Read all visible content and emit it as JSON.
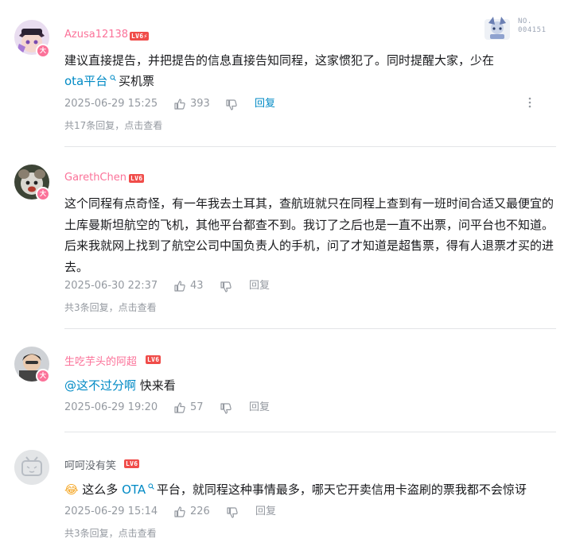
{
  "comments": [
    {
      "username": "Azusa12138",
      "level": "LV6",
      "badge_glyph": "⚡",
      "vip": "大",
      "content_parts": [
        "建议直接提告，并把提告的信息直接告知同程，这家惯犯了。同时提醒大家，少在",
        "ota平台",
        "买机票"
      ],
      "date": "2025-06-29 15:25",
      "likes": "393",
      "reply_label": "回复",
      "reply_summary": "共17条回复，点击查看",
      "nft_label": "NO.",
      "nft_number": "004151"
    },
    {
      "username": "GarethChen",
      "level": "LV6",
      "vip": "大",
      "content": "这个同程有点奇怪，有一年我去土耳其，查航班就只在同程上查到有一班时间合适又最便宜的土库曼斯坦航空的飞机，其他平台都查不到。我订了之后也是一直不出票，问平台也不知道。后来我就网上找到了航空公司中国负责人的手机，问了才知道是超售票，得有人退票才买的进去。",
      "date": "2025-06-30 22:37",
      "likes": "43",
      "reply_label": "回复",
      "reply_summary": "共3条回复，点击查看"
    },
    {
      "username": "生吃芋头的阿超",
      "level": "LV6",
      "vip": "大",
      "mention": "@这不过分啊",
      "content": " 快来看",
      "date": "2025-06-29 19:20",
      "likes": "57",
      "reply_label": "回复"
    },
    {
      "username": "呵呵没有笑",
      "level": "LV6",
      "emoji": "😂",
      "content_parts": [
        " 这么多 ",
        "OTA",
        " 平台，就同程这种事情最多，哪天它开卖信用卡盗刷的票我都不会惊讶"
      ],
      "date": "2025-06-29 15:14",
      "likes": "226",
      "reply_label": "回复",
      "reply_summary": "共3条回复，点击查看"
    }
  ],
  "icons": {
    "like": "thumb-up-icon",
    "dislike": "thumb-down-icon",
    "search_sup": "search-icon",
    "more": "more-vertical-icon"
  },
  "colors": {
    "username_pink": "#fb7299",
    "link_blue": "#008ac5",
    "meta_gray": "#9499a0",
    "level_red": "#f04c49"
  }
}
